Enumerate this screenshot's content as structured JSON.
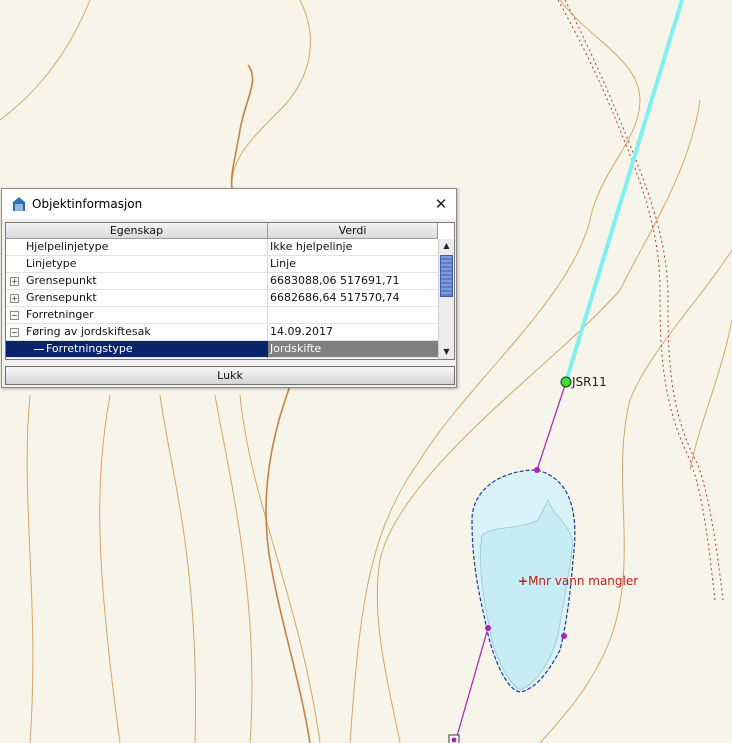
{
  "map": {
    "point_label": "JSR11",
    "warning_marker": "+",
    "warning_label": "Mnr vann mangler",
    "colors": {
      "background": "#f7f4ea",
      "contour": "#d8a56a",
      "contour_bold": "#c4834a",
      "boundary": "#c0392b",
      "cyan_line": "#7ff0f0",
      "magenta_line": "#b020c0",
      "lake_fill": "#d8f2f8",
      "lake_outline": "#1a3c9a"
    }
  },
  "dialog": {
    "title": "Objektinformasjon",
    "icon": "house-icon",
    "close_icon": "close-icon",
    "columns": [
      "Egenskap",
      "Verdi"
    ],
    "rows": [
      {
        "property": "Hjelpelinjetype",
        "value": "Ikke hjelpelinje",
        "expander": ""
      },
      {
        "property": "Linjetype",
        "value": "Linje",
        "expander": ""
      },
      {
        "property": "Grensepunkt",
        "value": "6683088,06 517691,71",
        "expander": "+"
      },
      {
        "property": "Grensepunkt",
        "value": "6682686,64 517570,74",
        "expander": "+"
      },
      {
        "property": "Forretninger",
        "value": "",
        "expander": "−"
      },
      {
        "property": "Føring av jordskiftesak",
        "value": "14.09.2017",
        "expander": "−"
      },
      {
        "property": "Forretningstype",
        "value": "Jordskifte",
        "expander": "",
        "selected": true
      }
    ],
    "scroll_up_icon": "▲",
    "scroll_down_icon": "▼",
    "close_button": "Lukk"
  }
}
